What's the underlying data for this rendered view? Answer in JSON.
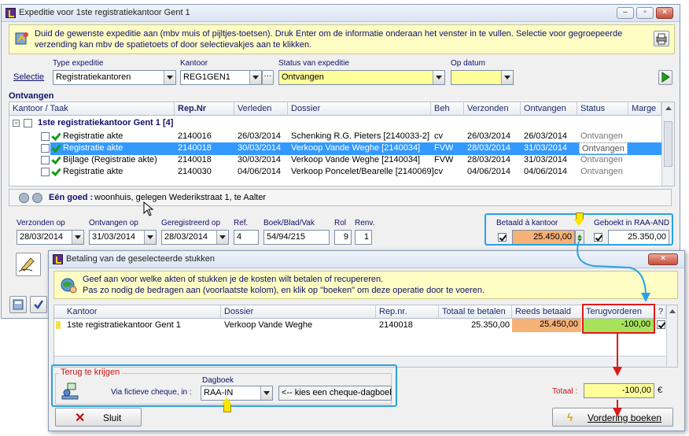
{
  "main_window": {
    "title": "Expeditie voor 1ste registratiekantoor Gent 1",
    "info": "Duid de gewenste expeditie aan (mbv muis of pijltjes-toetsen). Druk Enter om de informatie onderaan het venster in te vullen. Selectie voor gegroepeerde verzending kan mbv de spatietoets of door selectievakjes aan te klikken."
  },
  "selection": {
    "label": "Selectie",
    "type_label": "Type expeditie",
    "type_value": "Registratiekantoren",
    "kantoor_label": "Kantoor",
    "kantoor_value": "REG1GEN1",
    "kantoor_more": "···",
    "status_label": "Status van expeditie",
    "status_value": "Ontvangen",
    "datum_label": "Op datum",
    "datum_value": ""
  },
  "grid": {
    "section_title": "Ontvangen",
    "columns": [
      "Kantoor / Taak",
      "Rep.Nr",
      "Verleden",
      "Dossier",
      "Beh",
      "Verzonden",
      "Ontvangen",
      "Status",
      "Marge"
    ],
    "group_label": "1ste registratiekantoor Gent 1 [4]",
    "rows": [
      {
        "taak": "Registratie akte",
        "repnr": "2140016",
        "verleden": "26/03/2014",
        "dossier": "Schenking R.G. Pieters [2140033-2]",
        "beh": "cv",
        "verzonden": "26/03/2014",
        "ontvangen": "26/03/2014",
        "status": "Ontvangen"
      },
      {
        "taak": "Registratie akte",
        "repnr": "2140018",
        "verleden": "30/03/2014",
        "dossier": "Verkoop Vande Weghe [2140034]",
        "beh": "FVW",
        "verzonden": "28/03/2014",
        "ontvangen": "31/03/2014",
        "status": "Ontvangen"
      },
      {
        "taak": "Bijlage (Registratie akte)",
        "repnr": "2140018",
        "verleden": "30/03/2014",
        "dossier": "Verkoop Vande Weghe [2140034]",
        "beh": "FVW",
        "verzonden": "28/03/2014",
        "ontvangen": "31/03/2014",
        "status": "Ontvangen"
      },
      {
        "taak": "Registratie akte",
        "repnr": "2140030",
        "verleden": "04/06/2014",
        "dossier": "Verkoop Poncelet/Bearelle [2140069]",
        "beh": "cv",
        "verzonden": "04/06/2014",
        "ontvangen": "04/06/2014",
        "status": "Ontvangen"
      }
    ],
    "goed_label": "Eén goed :",
    "goed_value": "woonhuis, gelegen Wederikstraat 1, te Aalter"
  },
  "details": {
    "verzonden_label": "Verzonden op",
    "verzonden_value": "28/03/2014",
    "ontvangen_label": "Ontvangen op",
    "ontvangen_value": "31/03/2014",
    "geregistreerd_label": "Geregistreerd op",
    "geregistreerd_value": "28/03/2014",
    "ref_label": "Ref.",
    "ref_value": "4",
    "boek_label": "Boek/Blad/Vak",
    "boek_value": "54/94/215",
    "rol_label": "Rol",
    "rol_value": "9",
    "renv_label": "Renv.",
    "renv_value": "1",
    "betaald_label": "Betaald à kantoor",
    "betaald_value": "25.450,00",
    "geboekt_label": "Geboekt in RAA-AND",
    "geboekt_value": "25.350,00"
  },
  "dialog": {
    "title": "Betaling van de geselecteerde stukken",
    "info_line1": "Geef aan voor welke akten of stukken je de kosten wilt betalen of recupereren.",
    "info_line2": "Pas zo nodig de bedragen aan (voorlaatste kolom), en klik op \"boeken\" om deze operatie door te voeren.",
    "columns": [
      "Kantoor",
      "Dossier",
      "Rep.nr.",
      "Totaal te betalen",
      "Reeds betaald",
      "Terugvorderen",
      "?"
    ],
    "row": {
      "kantoor": "1ste registratiekantoor Gent 1",
      "dossier": "Verkoop Vande Weghe",
      "repnr": "2140018",
      "totaal": "25.350,00",
      "reeds": "25.450,00",
      "terug": "-100,00"
    },
    "terug_title": "Terug te krijgen",
    "dagboek_label": "Dagboek",
    "via_label": "Via fictieve cheque, in :",
    "dagboek_value": "RAA-IN",
    "hint": "<-- kies een cheque-dagboek",
    "totaal_label": "Totaal :",
    "totaal_value": "-100,00",
    "currency": "€",
    "sluit_label": "Sluit",
    "boeken_label": "Vordering boeken"
  },
  "colors": {
    "accent_blue": "#2aa1e2",
    "highlight_red": "#dd1a1a",
    "selected_row": "#3399ff",
    "info_yellow": "#fdfdc4"
  }
}
